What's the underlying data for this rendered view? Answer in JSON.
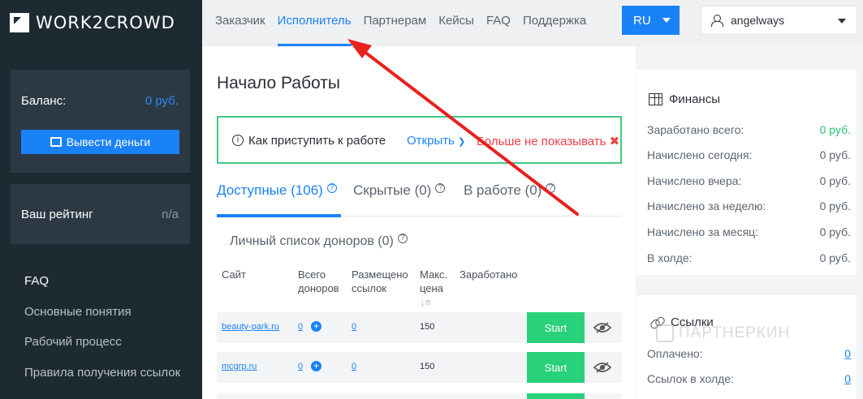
{
  "brand": {
    "name": "WORK2CROWD"
  },
  "sidebar": {
    "balance_label": "Баланс:",
    "balance_value": "0 руб.",
    "withdraw_label": "Вывести деньги",
    "rating_label": "Ваш рейтинг",
    "rating_value": "n/a",
    "nav_items": [
      "FAQ",
      "Основные понятия",
      "Рабочий процесс",
      "Правила получения ссылок"
    ]
  },
  "topnav": {
    "items": [
      "Заказчик",
      "Исполнитель",
      "Партнерам",
      "Кейсы",
      "FAQ",
      "Поддержка"
    ],
    "active": "Исполнитель",
    "lang": "RU",
    "username": "angelways"
  },
  "main": {
    "title": "Начало Работы",
    "howto": {
      "text": "Как приступить к работе",
      "open_label": "Открыть",
      "hide_label": "Больше не показывать"
    },
    "tabs": [
      {
        "label": "Доступные (106)",
        "active": true
      },
      {
        "label": "Скрытые (0)",
        "active": false
      },
      {
        "label": "В работе (0)",
        "active": false
      }
    ],
    "donors_link": "Личный список доноров (0)",
    "table": {
      "headers": {
        "site": "Сайт",
        "donors": [
          "Всего",
          "доноров"
        ],
        "links": [
          "Размещено",
          "ссылок"
        ],
        "price": [
          "Макс.",
          "цена"
        ],
        "earned": "Заработано"
      },
      "rows": [
        {
          "site": "beauty-park.ru",
          "donors": "0",
          "links": "0",
          "price": "150",
          "action": "Start"
        },
        {
          "site": "mcgrp.ru",
          "donors": "0",
          "links": "0",
          "price": "150",
          "action": "Start"
        }
      ]
    }
  },
  "finance": {
    "title": "Финансы",
    "rows": [
      {
        "label": "Заработано всего:",
        "value": "0 руб."
      },
      {
        "label": "Начислено сегодня:",
        "value": "0 руб."
      },
      {
        "label": "Начислено вчера:",
        "value": "0 руб."
      },
      {
        "label": "Начислено за неделю:",
        "value": "0 руб."
      },
      {
        "label": "Начислено за месяц:",
        "value": "0 руб."
      },
      {
        "label": "В холде:",
        "value": "0 руб."
      }
    ]
  },
  "links": {
    "title": "Ссылки",
    "rows": [
      {
        "label": "Оплачено:",
        "value": "0"
      },
      {
        "label": "Ссылок в холде:",
        "value": "0"
      }
    ]
  },
  "watermark": "ПАРТНЕРКИН",
  "colors": {
    "accent": "#1a82f7",
    "success": "#29d17a",
    "danger": "#ee4149",
    "sidebar": "#1e2a32",
    "annotation_arrow": "#e8201e"
  }
}
